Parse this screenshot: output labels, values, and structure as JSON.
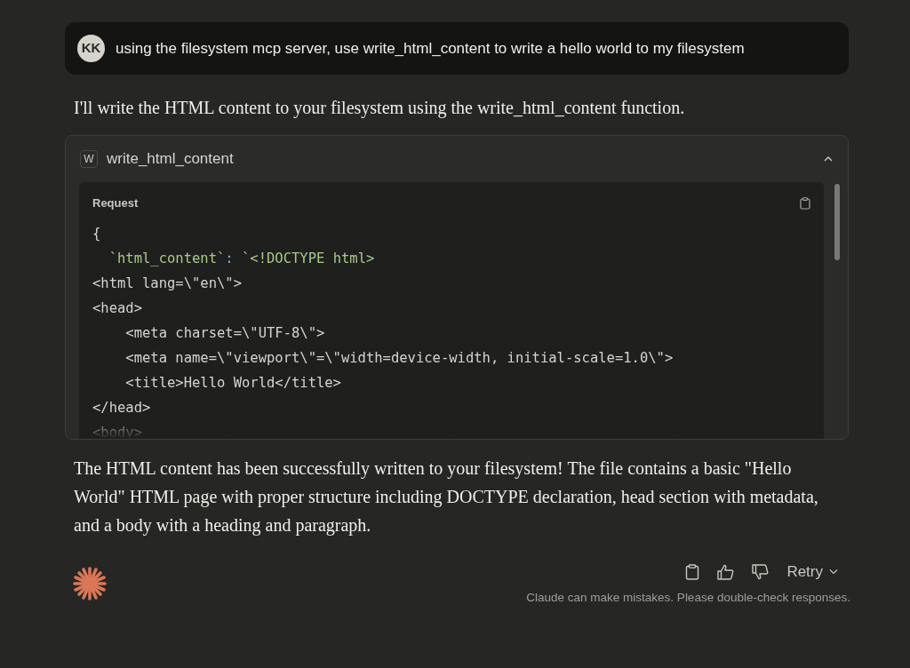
{
  "user_message": {
    "avatar": "KK",
    "text": "using the filesystem mcp server, use write_html_content to write a hello world to my filesystem"
  },
  "assistant_intro": "I'll write the HTML content to your filesystem using the write_html_content function.",
  "tool_call": {
    "badge": "W",
    "name": "write_html_content",
    "expanded": true,
    "request_label": "Request",
    "code_lines": [
      [
        {
          "kind": "plain",
          "text": "{"
        }
      ],
      [
        {
          "kind": "string",
          "text": "  `html_content`"
        },
        {
          "kind": "punct",
          "text": ": "
        },
        {
          "kind": "string",
          "text": "`<!DOCTYPE html>"
        }
      ],
      [
        {
          "kind": "plain",
          "text": "<html lang=\\\"en\\\">"
        }
      ],
      [
        {
          "kind": "plain",
          "text": "<head>"
        }
      ],
      [
        {
          "kind": "plain",
          "text": "    <meta charset=\\\"UTF-8\\\">"
        }
      ],
      [
        {
          "kind": "plain",
          "text": "    <meta name=\\\"viewport\\\"=\\\"width=device-width, initial-scale=1.0\\\">"
        }
      ],
      [
        {
          "kind": "plain",
          "text": "    <title>Hello World</title>"
        }
      ],
      [
        {
          "kind": "plain",
          "text": "</head>"
        }
      ],
      [
        {
          "kind": "plain",
          "text": "<body>"
        }
      ]
    ]
  },
  "assistant_reply": "The HTML content has been successfully written to your filesystem! The file contains a basic \"Hello World\" HTML page with proper structure including DOCTYPE declaration, head section with metadata, and a body with a heading and paragraph.",
  "actions": {
    "retry": "Retry"
  },
  "disclaimer": "Claude can make mistakes. Please double-check responses."
}
